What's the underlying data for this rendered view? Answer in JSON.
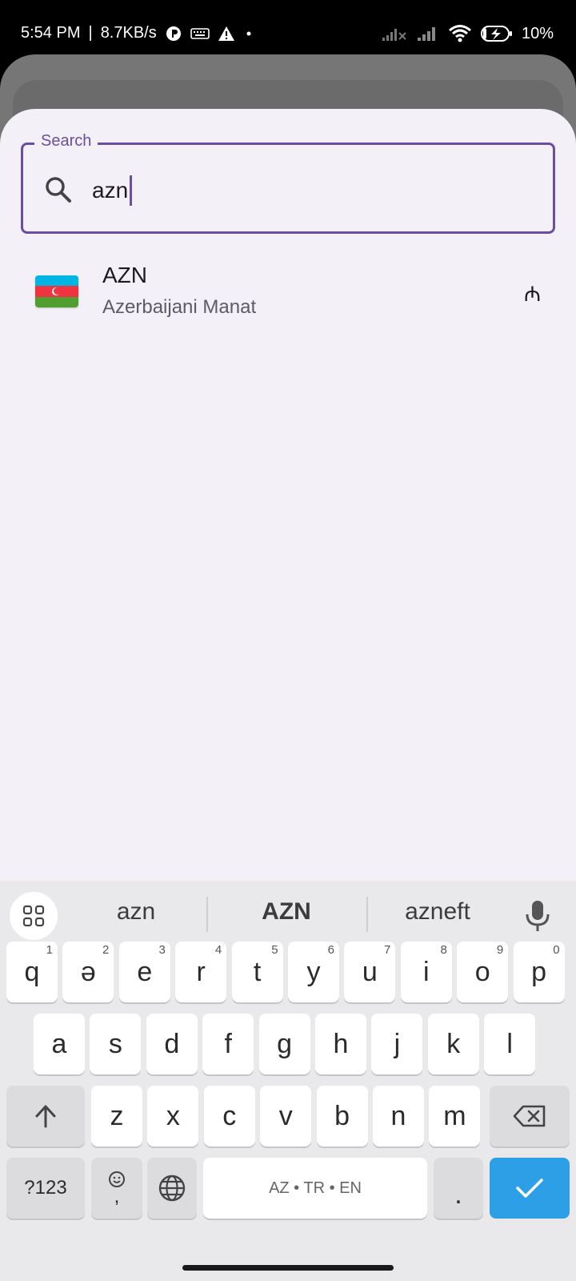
{
  "status_bar": {
    "time": "5:54 PM",
    "separator": "|",
    "speed": "8.7KB/s",
    "battery": "10%",
    "icons": [
      "data-saver-icon",
      "keyboard-icon",
      "warning-icon",
      "dot-icon",
      "no-signal-icon",
      "signal-icon",
      "wifi-icon",
      "battery-charging-icon"
    ]
  },
  "search": {
    "label": "Search",
    "value": "azn"
  },
  "results": [
    {
      "code": "AZN",
      "name": "Azerbaijani Manat",
      "symbol": "₼",
      "flag": "azerbaijan-flag-icon"
    }
  ],
  "keyboard": {
    "suggestions": [
      "azn",
      "AZN",
      "azneft"
    ],
    "row1": [
      {
        "k": "q",
        "h": "1"
      },
      {
        "k": "ə",
        "h": "2"
      },
      {
        "k": "e",
        "h": "3"
      },
      {
        "k": "r",
        "h": "4"
      },
      {
        "k": "t",
        "h": "5"
      },
      {
        "k": "y",
        "h": "6"
      },
      {
        "k": "u",
        "h": "7"
      },
      {
        "k": "i",
        "h": "8"
      },
      {
        "k": "o",
        "h": "9"
      },
      {
        "k": "p",
        "h": "0"
      }
    ],
    "row2": [
      "a",
      "s",
      "d",
      "f",
      "g",
      "h",
      "j",
      "k",
      "l"
    ],
    "row3": [
      "z",
      "x",
      "c",
      "v",
      "b",
      "n",
      "m"
    ],
    "symbols_label": "?123",
    "comma": ",",
    "space_label": "AZ • TR • EN",
    "period": ".",
    "colors": {
      "enter": "#2c9fe6",
      "accent": "#6b4ea1"
    }
  }
}
